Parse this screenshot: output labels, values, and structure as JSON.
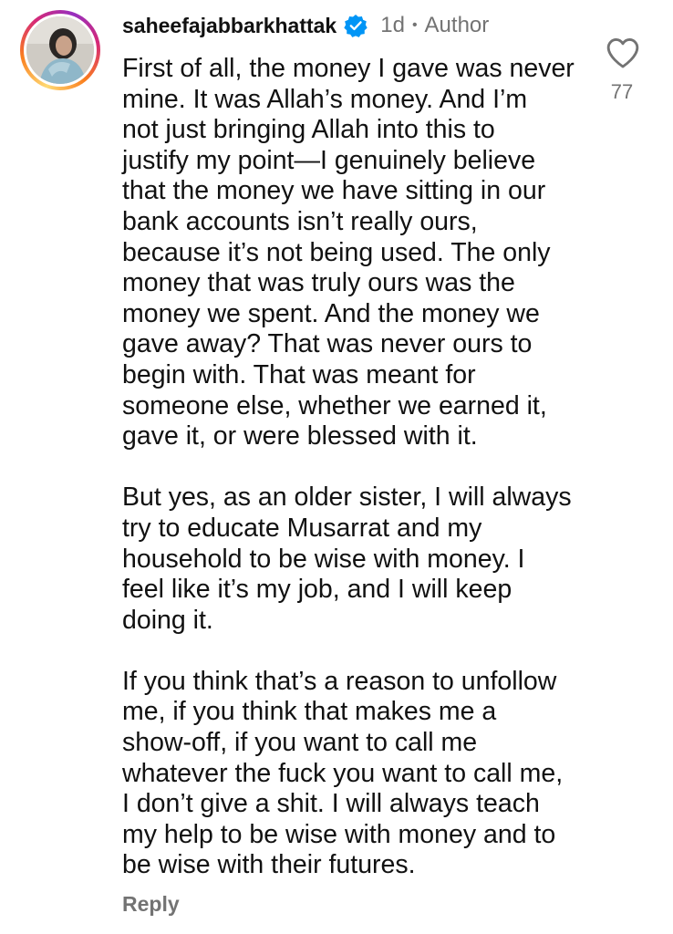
{
  "comment": {
    "username": "saheefajabbarkhattak",
    "time": "1d",
    "separator": "•",
    "role": "Author",
    "icons": {
      "avatar": "profile-photo",
      "verified": "verified-badge-icon",
      "like": "heart-outline-icon"
    },
    "colors": {
      "verified": "#0095f6",
      "muted": "#737373",
      "text": "#111111"
    },
    "paragraphs": [
      [
        "First of all, the money I gave was never",
        "mine. It was Allah’s money. And I’m",
        "not just bringing Allah into this to",
        "justify my point—I genuinely believe",
        "that the money we have sitting in our",
        "bank accounts isn’t really ours,",
        "because it’s not being used. The only",
        "money that was truly ours was the",
        "money we spent. And the money we",
        "gave away? That was never ours to",
        "begin with. That was meant for",
        "someone else, whether we earned it,",
        "gave it, or were blessed with it."
      ],
      [
        "But yes, as an older sister, I will always",
        "try to educate Musarrat and my",
        "household to be wise with money. I",
        "feel like it’s my job, and I will keep",
        "doing it."
      ],
      [
        "If you think that’s a reason to unfollow",
        "me, if you think that makes me a",
        "show-off, if you want to call me",
        "whatever the fuck you want to call me,",
        "I don’t give a shit. I will always teach",
        "my help to be wise with money and to",
        "be wise with their futures."
      ]
    ],
    "like_count": "77",
    "reply_label": "Reply"
  }
}
